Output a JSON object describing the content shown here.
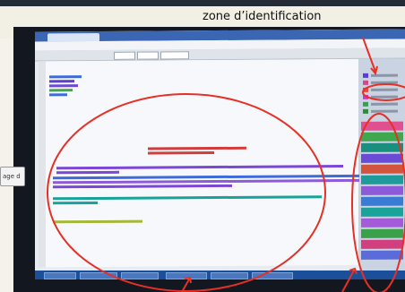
{
  "annotation": {
    "label": "zone d’identification",
    "circle_color": "#e53025",
    "arrow_color": "#e53025"
  },
  "side_card": {
    "text": "age d"
  },
  "palette": {
    "panel_bg": "#c9d3e1",
    "editor_bg": "#f7f8fb",
    "taskbar": "#1c4f9a",
    "highlight_purple": "#7b47d6",
    "highlight_red": "#d23c3c",
    "highlight_teal": "#18a39a",
    "highlight_olive": "#a5b83a",
    "highlight_blue": "#3f6bd9",
    "highlight_green": "#3fa84e"
  },
  "legend_swatches": [
    "#5b3fd2",
    "#d04a8a",
    "#e34b3a",
    "#c83ad6",
    "#3e9b58",
    "#2f8a3a"
  ],
  "right_blocks": [
    "#e0508f",
    "#3fa84e",
    "#1a8f7f",
    "#6a4bd6",
    "#d2543d",
    "#1f9a9a",
    "#8d5bd9",
    "#3a7bd5",
    "#1aa39a",
    "#a35bd9",
    "#3aa04a",
    "#d23f7f",
    "#5b6bd9"
  ]
}
